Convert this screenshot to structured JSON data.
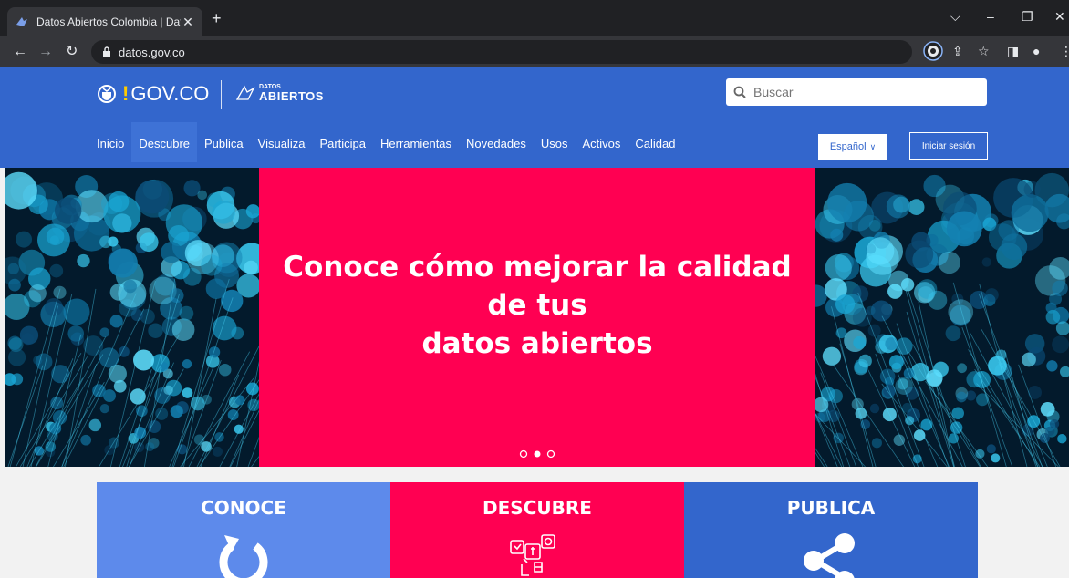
{
  "browser": {
    "tab_title": "Datos Abiertos Colombia | Datos",
    "url": "datos.gov.co"
  },
  "header": {
    "gov_logo": "GOV.CO",
    "datos_logo_top": "DATOS",
    "datos_logo_bottom": "ABIERTOS",
    "search_placeholder": "Buscar",
    "menu": [
      "Inicio",
      "Descubre",
      "Publica",
      "Visualiza",
      "Participa",
      "Herramientas",
      "Novedades",
      "Usos",
      "Activos",
      "Calidad"
    ],
    "active_menu_index": 1,
    "language": "Español",
    "login": "Iniciar sesión"
  },
  "hero": {
    "title_line1": "Conoce cómo mejorar la calidad de tus",
    "title_line2": "datos abiertos",
    "slide_count": 3,
    "active_slide": 1
  },
  "cards": [
    {
      "label": "CONOCE",
      "color": "#5d8aeb",
      "icon": "refresh-icon"
    },
    {
      "label": "DESCUBRE",
      "color": "#ff0052",
      "icon": "social-network-icon"
    },
    {
      "label": "PUBLICA",
      "color": "#3366cc",
      "icon": "share-icon"
    }
  ],
  "colors": {
    "brand_blue": "#3366cc",
    "accent_pink": "#ff0052"
  }
}
